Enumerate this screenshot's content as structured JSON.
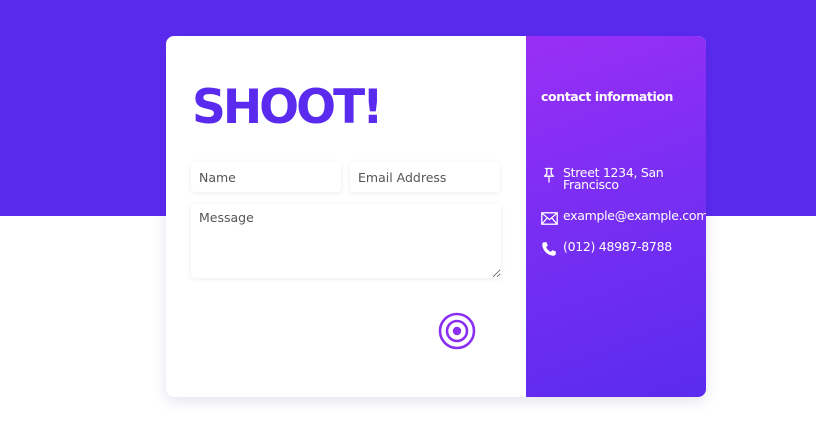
{
  "form": {
    "title": "SHOOT!",
    "name_placeholder": "Name",
    "email_placeholder": "Email Address",
    "message_placeholder": "Message",
    "send_icon": "target-send-icon"
  },
  "contact": {
    "title": "contact information",
    "address": "Street 1234, San Francisco",
    "email": "example@example.com",
    "phone": "(012) 48987-8788",
    "icons": [
      "pushpin-icon",
      "envelope-icon",
      "phone-icon"
    ]
  },
  "colors": {
    "accent": "#5a2bef",
    "gradient_start": "#9a2ff6",
    "gradient_end": "#5a2bef",
    "send_button": "#8a2ef2"
  }
}
